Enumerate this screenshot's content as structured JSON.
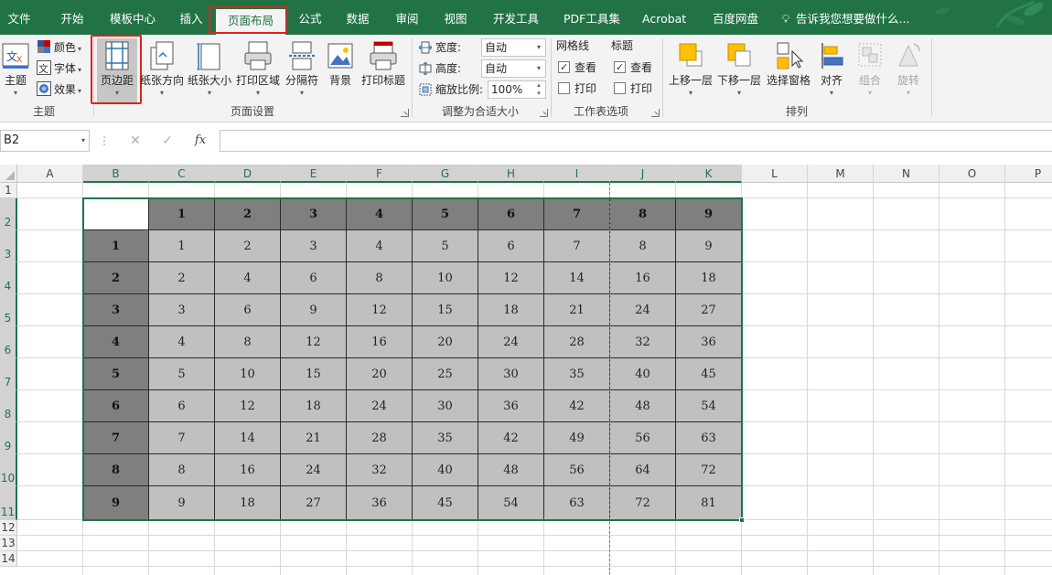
{
  "menu": {
    "tabs": [
      "文件",
      "开始",
      "模板中心",
      "插入",
      "页面布局",
      "公式",
      "数据",
      "审阅",
      "视图",
      "开发工具",
      "PDF工具集",
      "Acrobat",
      "百度网盘"
    ],
    "active": "页面布局",
    "tell_me": "告诉我您想要做什么..."
  },
  "ribbon": {
    "themes": {
      "group_label": "主题",
      "theme_btn": "主题",
      "colors": "颜色",
      "fonts": "字体",
      "effects": "效果"
    },
    "page_setup": {
      "group_label": "页面设置",
      "margins": "页边距",
      "orientation": "纸张方向",
      "size": "纸张大小",
      "print_area": "打印区域",
      "breaks": "分隔符",
      "background": "背景",
      "print_titles": "打印标题"
    },
    "scale": {
      "group_label": "调整为合适大小",
      "width_label": "宽度:",
      "width_value": "自动",
      "height_label": "高度:",
      "height_value": "自动",
      "scale_label": "缩放比例:",
      "scale_value": "100%"
    },
    "sheet_options": {
      "group_label": "工作表选项",
      "gridlines": "网格线",
      "headings": "标题",
      "view": "查看",
      "print": "打印"
    },
    "arrange": {
      "group_label": "排列",
      "bring_forward": "上移一层",
      "send_backward": "下移一层",
      "selection_pane": "选择窗格",
      "align": "对齐",
      "group": "组合",
      "rotate": "旋转"
    }
  },
  "formula_bar": {
    "name_box": "B2",
    "fx": "fx",
    "formula": ""
  },
  "grid": {
    "columns": [
      "A",
      "B",
      "C",
      "D",
      "E",
      "F",
      "G",
      "H",
      "I",
      "J",
      "K",
      "L",
      "M",
      "N",
      "O",
      "P"
    ],
    "rows": [
      "1",
      "2",
      "3",
      "4",
      "5",
      "6",
      "7",
      "8",
      "9",
      "10",
      "11",
      "12",
      "13",
      "14"
    ],
    "table": {
      "col_headers": [
        "1",
        "2",
        "3",
        "4",
        "5",
        "6",
        "7",
        "8",
        "9"
      ],
      "row_headers": [
        "1",
        "2",
        "3",
        "4",
        "5",
        "6",
        "7",
        "8",
        "9"
      ],
      "values": [
        [
          1,
          2,
          3,
          4,
          5,
          6,
          7,
          8,
          9
        ],
        [
          2,
          4,
          6,
          8,
          10,
          12,
          14,
          16,
          18
        ],
        [
          3,
          6,
          9,
          12,
          15,
          18,
          21,
          24,
          27
        ],
        [
          4,
          8,
          12,
          16,
          20,
          24,
          28,
          32,
          36
        ],
        [
          5,
          10,
          15,
          20,
          25,
          30,
          35,
          40,
          45
        ],
        [
          6,
          12,
          18,
          24,
          30,
          36,
          42,
          48,
          54
        ],
        [
          7,
          14,
          21,
          28,
          35,
          42,
          49,
          56,
          63
        ],
        [
          8,
          16,
          24,
          32,
          40,
          48,
          56,
          64,
          72
        ],
        [
          9,
          18,
          27,
          36,
          45,
          54,
          63,
          72,
          81
        ]
      ]
    }
  },
  "colors": {
    "brand_green": "#217346",
    "highlight_red": "#e0211d"
  }
}
